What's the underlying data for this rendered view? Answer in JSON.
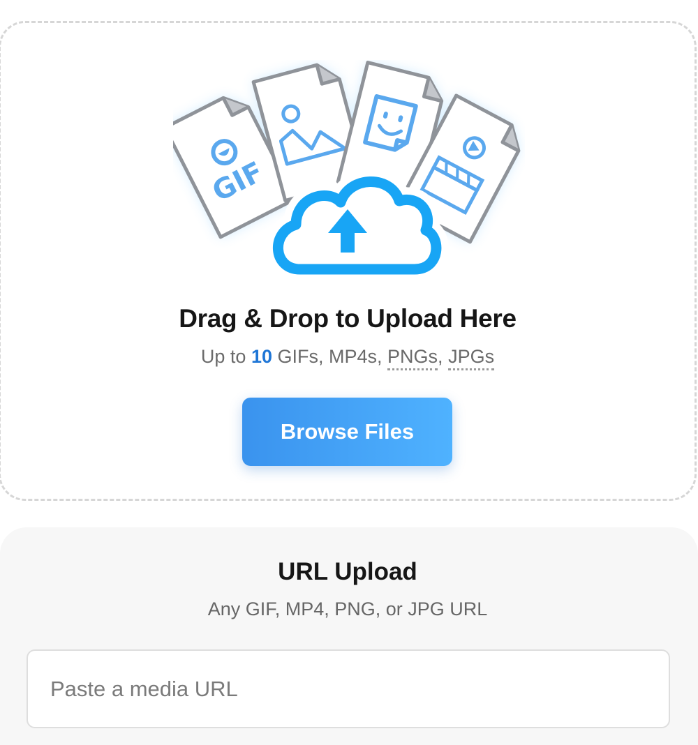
{
  "dropzone": {
    "headline": "Drag & Drop to Upload Here",
    "sub_prefix": "Up to ",
    "sub_count": "10",
    "sub_formats": " GIFs, MP4s, ",
    "sub_png": "PNGs",
    "sub_sep": ", ",
    "sub_jpg": "JPGs",
    "browse_label": "Browse Files",
    "gif_card_text": "GIF"
  },
  "url_upload": {
    "title": "URL Upload",
    "subtitle": "Any GIF, MP4, PNG, or JPG URL",
    "placeholder": "Paste a media URL",
    "value": ""
  },
  "colors": {
    "accent": "#1f76d6",
    "button_start": "#3a93ee",
    "button_end": "#4fb2ff",
    "icon_blue": "#5aa8ee",
    "cloud_blue": "#18a5f5"
  }
}
